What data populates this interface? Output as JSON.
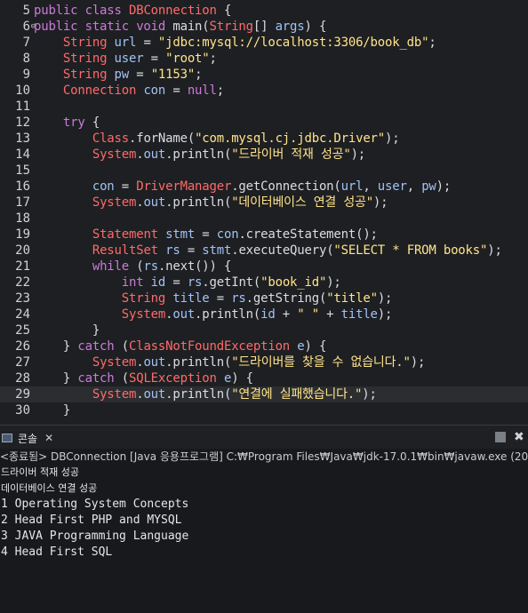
{
  "editor": {
    "lines": [
      {
        "n": "5",
        "tokens": [
          {
            "t": "public class ",
            "c": "kw"
          },
          {
            "t": "DBConnection",
            "c": "tp"
          },
          {
            "t": " {",
            "c": "pl"
          }
        ]
      },
      {
        "n": "6",
        "fold": "⊖",
        "tokens": [
          {
            "t": "public static void ",
            "c": "kw"
          },
          {
            "t": "main",
            "c": "pl"
          },
          {
            "t": "(",
            "c": "pl"
          },
          {
            "t": "String",
            "c": "tp"
          },
          {
            "t": "[] ",
            "c": "pl"
          },
          {
            "t": "args",
            "c": "var"
          },
          {
            "t": ") {",
            "c": "pl"
          }
        ]
      },
      {
        "n": "7",
        "tokens": [
          {
            "t": "    ",
            "c": "pl"
          },
          {
            "t": "String",
            "c": "tp"
          },
          {
            "t": " ",
            "c": "pl"
          },
          {
            "t": "url",
            "c": "var"
          },
          {
            "t": " = ",
            "c": "pl"
          },
          {
            "t": "\"jdbc:mysql://localhost:3306/book_db\"",
            "c": "str"
          },
          {
            "t": ";",
            "c": "pl"
          }
        ]
      },
      {
        "n": "8",
        "tokens": [
          {
            "t": "    ",
            "c": "pl"
          },
          {
            "t": "String",
            "c": "tp"
          },
          {
            "t": " ",
            "c": "pl"
          },
          {
            "t": "user",
            "c": "var"
          },
          {
            "t": " = ",
            "c": "pl"
          },
          {
            "t": "\"root\"",
            "c": "str"
          },
          {
            "t": ";",
            "c": "pl"
          }
        ]
      },
      {
        "n": "9",
        "tokens": [
          {
            "t": "    ",
            "c": "pl"
          },
          {
            "t": "String",
            "c": "tp"
          },
          {
            "t": " ",
            "c": "pl"
          },
          {
            "t": "pw",
            "c": "var"
          },
          {
            "t": " = ",
            "c": "pl"
          },
          {
            "t": "\"1153\"",
            "c": "str"
          },
          {
            "t": ";",
            "c": "pl"
          }
        ]
      },
      {
        "n": "10",
        "tokens": [
          {
            "t": "    ",
            "c": "pl"
          },
          {
            "t": "Connection",
            "c": "tp"
          },
          {
            "t": " ",
            "c": "pl"
          },
          {
            "t": "con",
            "c": "var"
          },
          {
            "t": " = ",
            "c": "pl"
          },
          {
            "t": "null",
            "c": "kw"
          },
          {
            "t": ";",
            "c": "pl"
          }
        ]
      },
      {
        "n": "11",
        "tokens": []
      },
      {
        "n": "12",
        "tokens": [
          {
            "t": "    ",
            "c": "pl"
          },
          {
            "t": "try",
            "c": "kw"
          },
          {
            "t": " {",
            "c": "pl"
          }
        ]
      },
      {
        "n": "13",
        "tokens": [
          {
            "t": "        ",
            "c": "pl"
          },
          {
            "t": "Class",
            "c": "tp"
          },
          {
            "t": ".forName(",
            "c": "pl"
          },
          {
            "t": "\"com.mysql.cj.jdbc.Driver\"",
            "c": "str"
          },
          {
            "t": ");",
            "c": "pl"
          }
        ]
      },
      {
        "n": "14",
        "tokens": [
          {
            "t": "        ",
            "c": "pl"
          },
          {
            "t": "System",
            "c": "tp"
          },
          {
            "t": ".",
            "c": "pl"
          },
          {
            "t": "out",
            "c": "fld"
          },
          {
            "t": ".println(",
            "c": "pl"
          },
          {
            "t": "\"드라이버 적재 성공\"",
            "c": "str"
          },
          {
            "t": ");",
            "c": "pl"
          }
        ]
      },
      {
        "n": "15",
        "tokens": []
      },
      {
        "n": "16",
        "tokens": [
          {
            "t": "        ",
            "c": "pl"
          },
          {
            "t": "con",
            "c": "var"
          },
          {
            "t": " = ",
            "c": "pl"
          },
          {
            "t": "DriverManager",
            "c": "tp"
          },
          {
            "t": ".getConnection(",
            "c": "pl"
          },
          {
            "t": "url",
            "c": "var"
          },
          {
            "t": ", ",
            "c": "pl"
          },
          {
            "t": "user",
            "c": "var"
          },
          {
            "t": ", ",
            "c": "pl"
          },
          {
            "t": "pw",
            "c": "var"
          },
          {
            "t": ");",
            "c": "pl"
          }
        ]
      },
      {
        "n": "17",
        "tokens": [
          {
            "t": "        ",
            "c": "pl"
          },
          {
            "t": "System",
            "c": "tp"
          },
          {
            "t": ".",
            "c": "pl"
          },
          {
            "t": "out",
            "c": "fld"
          },
          {
            "t": ".println(",
            "c": "pl"
          },
          {
            "t": "\"데이터베이스 연결 성공\"",
            "c": "str"
          },
          {
            "t": ");",
            "c": "pl"
          }
        ]
      },
      {
        "n": "18",
        "tokens": []
      },
      {
        "n": "19",
        "tokens": [
          {
            "t": "        ",
            "c": "pl"
          },
          {
            "t": "Statement",
            "c": "tp"
          },
          {
            "t": " ",
            "c": "pl"
          },
          {
            "t": "stmt",
            "c": "var"
          },
          {
            "t": " = ",
            "c": "pl"
          },
          {
            "t": "con",
            "c": "var"
          },
          {
            "t": ".createStatement();",
            "c": "pl"
          }
        ]
      },
      {
        "n": "20",
        "tokens": [
          {
            "t": "        ",
            "c": "pl"
          },
          {
            "t": "ResultSet",
            "c": "tp"
          },
          {
            "t": " ",
            "c": "pl"
          },
          {
            "t": "rs",
            "c": "var"
          },
          {
            "t": " = ",
            "c": "pl"
          },
          {
            "t": "stmt",
            "c": "var"
          },
          {
            "t": ".executeQuery(",
            "c": "pl"
          },
          {
            "t": "\"SELECT * FROM books\"",
            "c": "str"
          },
          {
            "t": ");",
            "c": "pl"
          }
        ]
      },
      {
        "n": "21",
        "tokens": [
          {
            "t": "        ",
            "c": "pl"
          },
          {
            "t": "while",
            "c": "kw"
          },
          {
            "t": " (",
            "c": "pl"
          },
          {
            "t": "rs",
            "c": "var"
          },
          {
            "t": ".next()) {",
            "c": "pl"
          }
        ]
      },
      {
        "n": "22",
        "tokens": [
          {
            "t": "            ",
            "c": "pl"
          },
          {
            "t": "int",
            "c": "kw"
          },
          {
            "t": " ",
            "c": "pl"
          },
          {
            "t": "id",
            "c": "var"
          },
          {
            "t": " = ",
            "c": "pl"
          },
          {
            "t": "rs",
            "c": "var"
          },
          {
            "t": ".getInt(",
            "c": "pl"
          },
          {
            "t": "\"book_id\"",
            "c": "str"
          },
          {
            "t": ");",
            "c": "pl"
          }
        ]
      },
      {
        "n": "23",
        "tokens": [
          {
            "t": "            ",
            "c": "pl"
          },
          {
            "t": "String",
            "c": "tp"
          },
          {
            "t": " ",
            "c": "pl"
          },
          {
            "t": "title",
            "c": "var"
          },
          {
            "t": " = ",
            "c": "pl"
          },
          {
            "t": "rs",
            "c": "var"
          },
          {
            "t": ".getString(",
            "c": "pl"
          },
          {
            "t": "\"title\"",
            "c": "str"
          },
          {
            "t": ");",
            "c": "pl"
          }
        ]
      },
      {
        "n": "24",
        "tokens": [
          {
            "t": "            ",
            "c": "pl"
          },
          {
            "t": "System",
            "c": "tp"
          },
          {
            "t": ".",
            "c": "pl"
          },
          {
            "t": "out",
            "c": "fld"
          },
          {
            "t": ".println(",
            "c": "pl"
          },
          {
            "t": "id",
            "c": "var"
          },
          {
            "t": " + ",
            "c": "pl"
          },
          {
            "t": "\" \"",
            "c": "str"
          },
          {
            "t": " + ",
            "c": "pl"
          },
          {
            "t": "title",
            "c": "var"
          },
          {
            "t": ");",
            "c": "pl"
          }
        ]
      },
      {
        "n": "25",
        "tokens": [
          {
            "t": "        }",
            "c": "pl"
          }
        ]
      },
      {
        "n": "26",
        "tokens": [
          {
            "t": "    } ",
            "c": "pl"
          },
          {
            "t": "catch",
            "c": "kw"
          },
          {
            "t": " (",
            "c": "pl"
          },
          {
            "t": "ClassNotFoundException",
            "c": "tp"
          },
          {
            "t": " ",
            "c": "pl"
          },
          {
            "t": "e",
            "c": "var"
          },
          {
            "t": ") {",
            "c": "pl"
          }
        ]
      },
      {
        "n": "27",
        "tokens": [
          {
            "t": "        ",
            "c": "pl"
          },
          {
            "t": "System",
            "c": "tp"
          },
          {
            "t": ".",
            "c": "pl"
          },
          {
            "t": "out",
            "c": "fld"
          },
          {
            "t": ".println(",
            "c": "pl"
          },
          {
            "t": "\"드라이버를 찾을 수 없습니다.\"",
            "c": "str"
          },
          {
            "t": ");",
            "c": "pl"
          }
        ]
      },
      {
        "n": "28",
        "tokens": [
          {
            "t": "    } ",
            "c": "pl"
          },
          {
            "t": "catch",
            "c": "kw"
          },
          {
            "t": " (",
            "c": "pl"
          },
          {
            "t": "SQLException",
            "c": "tp"
          },
          {
            "t": " ",
            "c": "pl"
          },
          {
            "t": "e",
            "c": "var"
          },
          {
            "t": ") {",
            "c": "pl"
          }
        ]
      },
      {
        "n": "29",
        "highlight": true,
        "tokens": [
          {
            "t": "        ",
            "c": "pl"
          },
          {
            "t": "System",
            "c": "tp"
          },
          {
            "t": ".",
            "c": "pl"
          },
          {
            "t": "out",
            "c": "fld"
          },
          {
            "t": ".println(",
            "c": "pl"
          },
          {
            "t": "\"연결에 실패했습니다.\"",
            "c": "str"
          },
          {
            "t": ");",
            "c": "pl"
          }
        ]
      },
      {
        "n": "30",
        "tokens": [
          {
            "t": "    }",
            "c": "pl"
          }
        ]
      }
    ]
  },
  "console": {
    "tab_label": "콘솔",
    "tab_close": "✕",
    "header": "<종료됨> DBConnection [Java 응용프로그램] C:₩Program Files₩Java₩jdk-17.0.1₩bin₩javaw.exe (20",
    "output": [
      {
        "text": "드라이버 적재 성공",
        "kr": true
      },
      {
        "text": "데이터베이스 연결 성공",
        "kr": true
      },
      {
        "text": "1 Operating System Concepts",
        "kr": false
      },
      {
        "text": "2 Head First PHP and MYSQL",
        "kr": false
      },
      {
        "text": "3 JAVA Programming Language",
        "kr": false
      },
      {
        "text": "4 Head First SQL",
        "kr": false
      }
    ]
  }
}
